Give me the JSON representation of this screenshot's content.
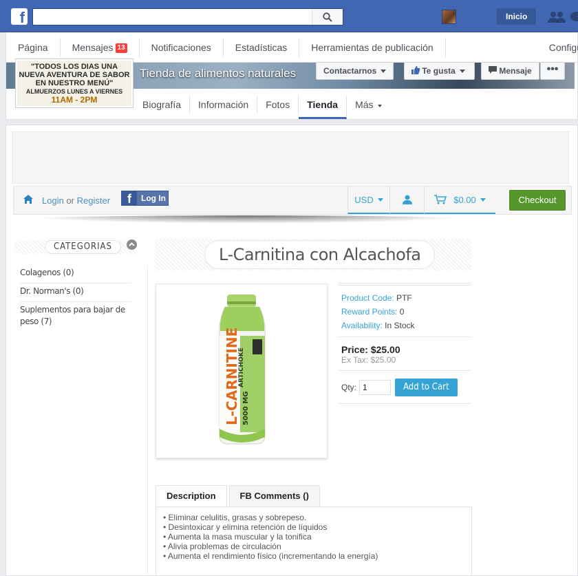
{
  "topbar": {
    "search_placeholder": "",
    "home_label": "Inicio"
  },
  "page_nav": {
    "items": [
      {
        "label": "Página"
      },
      {
        "label": "Mensajes",
        "badge": "13"
      },
      {
        "label": "Notificaciones"
      },
      {
        "label": "Estadísticas"
      },
      {
        "label": "Herramientas de publicación"
      },
      {
        "label": "Configu"
      }
    ]
  },
  "page": {
    "title": "Tienda de alimentos naturales",
    "profile_lines": [
      "\"TODOS LOS DIAS UNA",
      "NUEVA AVENTURA DE SABOR",
      "EN NUESTRO MENÚ\"",
      "ALMUERZOS LUNES A VIERNES",
      "11AM - 2PM"
    ],
    "btn_contact": "Contactarnos",
    "btn_like": "Te gusta",
    "btn_message": "Mensaje",
    "tabs": [
      "Biografía",
      "Información",
      "Fotos",
      "Tienda",
      "Más"
    ]
  },
  "store": {
    "login": "Login",
    "or": "or",
    "register": "Register",
    "fb_login": "Log In",
    "currency": "USD",
    "cart_total": "$0.00",
    "checkout": "Checkout",
    "categories_title": "CATEGORIAS",
    "categories": [
      "Colagenos (0)",
      "Dr. Norman's (0)",
      "Suplementos para bajar de peso (7)"
    ],
    "product": {
      "title": "L-Carnitina con Alcachofa",
      "code_label": "Product Code:",
      "code": "PTF",
      "reward_label": "Reward Points:",
      "reward": "0",
      "avail_label": "Availability:",
      "avail": "In Stock",
      "price_label": "Price:",
      "price": "$25.00",
      "extax": "Ex Tax: $25.00",
      "qty_label": "Qty:",
      "qty": "1",
      "add_to_cart": "Add to Cart",
      "bottle_brand": "L-CARNITINE",
      "bottle_sub": "5000 MG",
      "bottle_with": "ARTICHOKE"
    },
    "tabs": [
      "Description",
      "FB Comments ()"
    ],
    "description": [
      "Eliminar celulitis, grasas y sobrepeso.",
      "Desintoxicar y elimina retención de líquidos",
      "Aumenta la masa muscular y la tonifica",
      "Alivia problemas de circulación",
      "Aumenta el rendimiento físico (incrementando la energía)"
    ]
  },
  "colors": {
    "fb_blue": "#4267b2",
    "accent": "#35a3d4",
    "checkout_green": "#57962c",
    "badge_red": "#fa3e3e"
  }
}
